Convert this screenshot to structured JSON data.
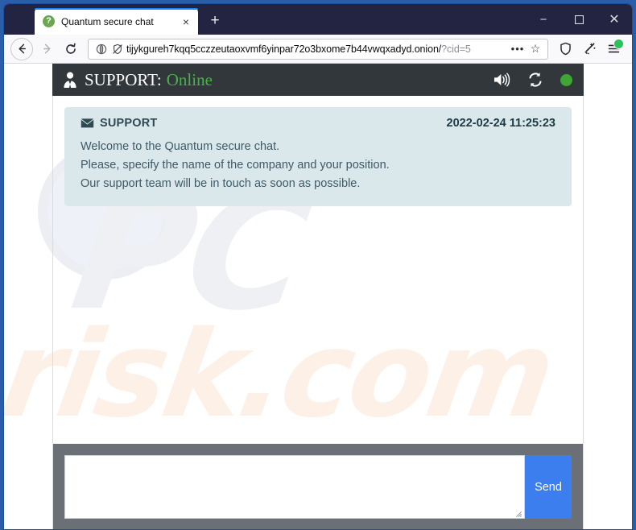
{
  "browser": {
    "tab": {
      "favicon_glyph": "?",
      "title": "Quantum secure chat",
      "close_glyph": "×"
    },
    "new_tab_glyph": "+",
    "window_controls": {
      "minimize": "−",
      "maximize": "□",
      "close": "✕"
    },
    "nav": {
      "back_glyph": "←",
      "forward_glyph": "→",
      "reload_glyph": "⟳"
    },
    "url": {
      "host_path": "tijykgureh7kqq5cczzeutaoxvmf6yinpar72o3bxome7b44vwqxadyd.onion/",
      "query": "?cid=5",
      "page_actions_glyph": "•••",
      "bookmark_glyph": "☆"
    },
    "toolbar": {
      "shield_name": "Tracking protection",
      "pocket_name": "Save to Pocket",
      "menu_name": "Open application menu"
    }
  },
  "chat": {
    "header": {
      "title": "SUPPORT:",
      "status": "Online",
      "sound_icon": "speaker-icon",
      "refresh_icon": "refresh-icon",
      "status_dot_color": "#3fa534"
    },
    "messages": [
      {
        "sender": "SUPPORT",
        "timestamp": "2022-02-24 11:25:23",
        "lines": [
          "Welcome to the Quantum secure chat.",
          "Please, specify the name of the company and your position.",
          "Our support team will be in touch as soon as possible."
        ]
      }
    ],
    "composer": {
      "input_value": "",
      "input_placeholder": "",
      "send_label": "Send",
      "send_color": "#3d7eee"
    }
  },
  "watermark": {
    "line1": "PC",
    "line2": "risk.com"
  }
}
